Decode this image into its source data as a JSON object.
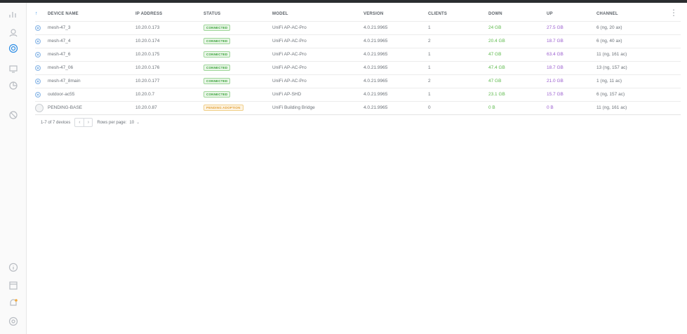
{
  "table": {
    "headers": [
      "DEVICE NAME",
      "IP ADDRESS",
      "STATUS",
      "MODEL",
      "VERSION",
      "CLIENTS",
      "DOWN",
      "UP",
      "CHANNEL"
    ],
    "sort_indicator": "↑",
    "rows": [
      {
        "name": "mesh-47_3",
        "ip": "10.20.0.173",
        "status": "CONNECTED",
        "status_type": "ok",
        "model": "UniFi AP-AC-Pro",
        "version": "4.0.21.9965",
        "clients": "1",
        "down": "24 GB",
        "up": "27.5 GB",
        "channel": "6 (ng, 20 ax)"
      },
      {
        "name": "mesh-47_4",
        "ip": "10.20.0.174",
        "status": "CONNECTED",
        "status_type": "ok",
        "model": "UniFi AP-AC-Pro",
        "version": "4.0.21.9965",
        "clients": "2",
        "down": "20.4 GB",
        "up": "18.7 GB",
        "channel": "6 (ng, 40 ax)"
      },
      {
        "name": "mesh-47_6",
        "ip": "10.20.0.175",
        "status": "CONNECTED",
        "status_type": "ok",
        "model": "UniFi AP-AC-Pro",
        "version": "4.0.21.9965",
        "clients": "1",
        "down": "47 GB",
        "up": "63.4 GB",
        "channel": "11 (ng, 161 ac)"
      },
      {
        "name": "mesh-47_06",
        "ip": "10.20.0.176",
        "status": "CONNECTED",
        "status_type": "ok",
        "model": "UniFi AP-AC-Pro",
        "version": "4.0.21.9965",
        "clients": "1",
        "down": "47.4 GB",
        "up": "18.7 GB",
        "channel": "13 (ng, 157 ac)"
      },
      {
        "name": "mesh-47_8main",
        "ip": "10.20.0.177",
        "status": "CONNECTED",
        "status_type": "ok",
        "model": "UniFi AP-AC-Pro",
        "version": "4.0.21.9965",
        "clients": "2",
        "down": "47 GB",
        "up": "21.0 GB",
        "channel": "1 (ng, 11 ac)"
      },
      {
        "name": "outdoor-ac55",
        "ip": "10.20.0.7",
        "status": "CONNECTED",
        "status_type": "ok",
        "model": "UniFi AP-SHD",
        "version": "4.0.21.9965",
        "clients": "1",
        "down": "23.1 GB",
        "up": "15.7 GB",
        "channel": "6 (ng, 157 ac)"
      },
      {
        "name": "PENDING-BASE",
        "ip": "10.20.0.87",
        "status": "PENDING ADOPTION",
        "status_type": "warn",
        "model": "UniFi Building Bridge",
        "version": "4.0.21.9965",
        "clients": "0",
        "down": "0 B",
        "up": "0 B",
        "channel": "11 (ng, 161 ac)"
      }
    ]
  },
  "pager": {
    "summary": "1-7 of 7 devices",
    "prev_glyph": "‹",
    "next_glyph": "›",
    "rows_label": "Rows per page:",
    "rows_value": "10",
    "rows_chevron": "⌄"
  },
  "more_glyph": "⋮",
  "colors": {
    "accent": "#2f8ee5",
    "ok": "#3aa33a",
    "warn": "#e3a33d",
    "down": "#5dba4c",
    "up": "#9b5fcf"
  },
  "sidebar_icons": [
    "chart-icon",
    "map-icon",
    "devices-icon",
    "clients-icon",
    "insights-icon",
    "shield-icon",
    "info-icon",
    "events-icon",
    "alerts-icon",
    "settings-icon"
  ]
}
